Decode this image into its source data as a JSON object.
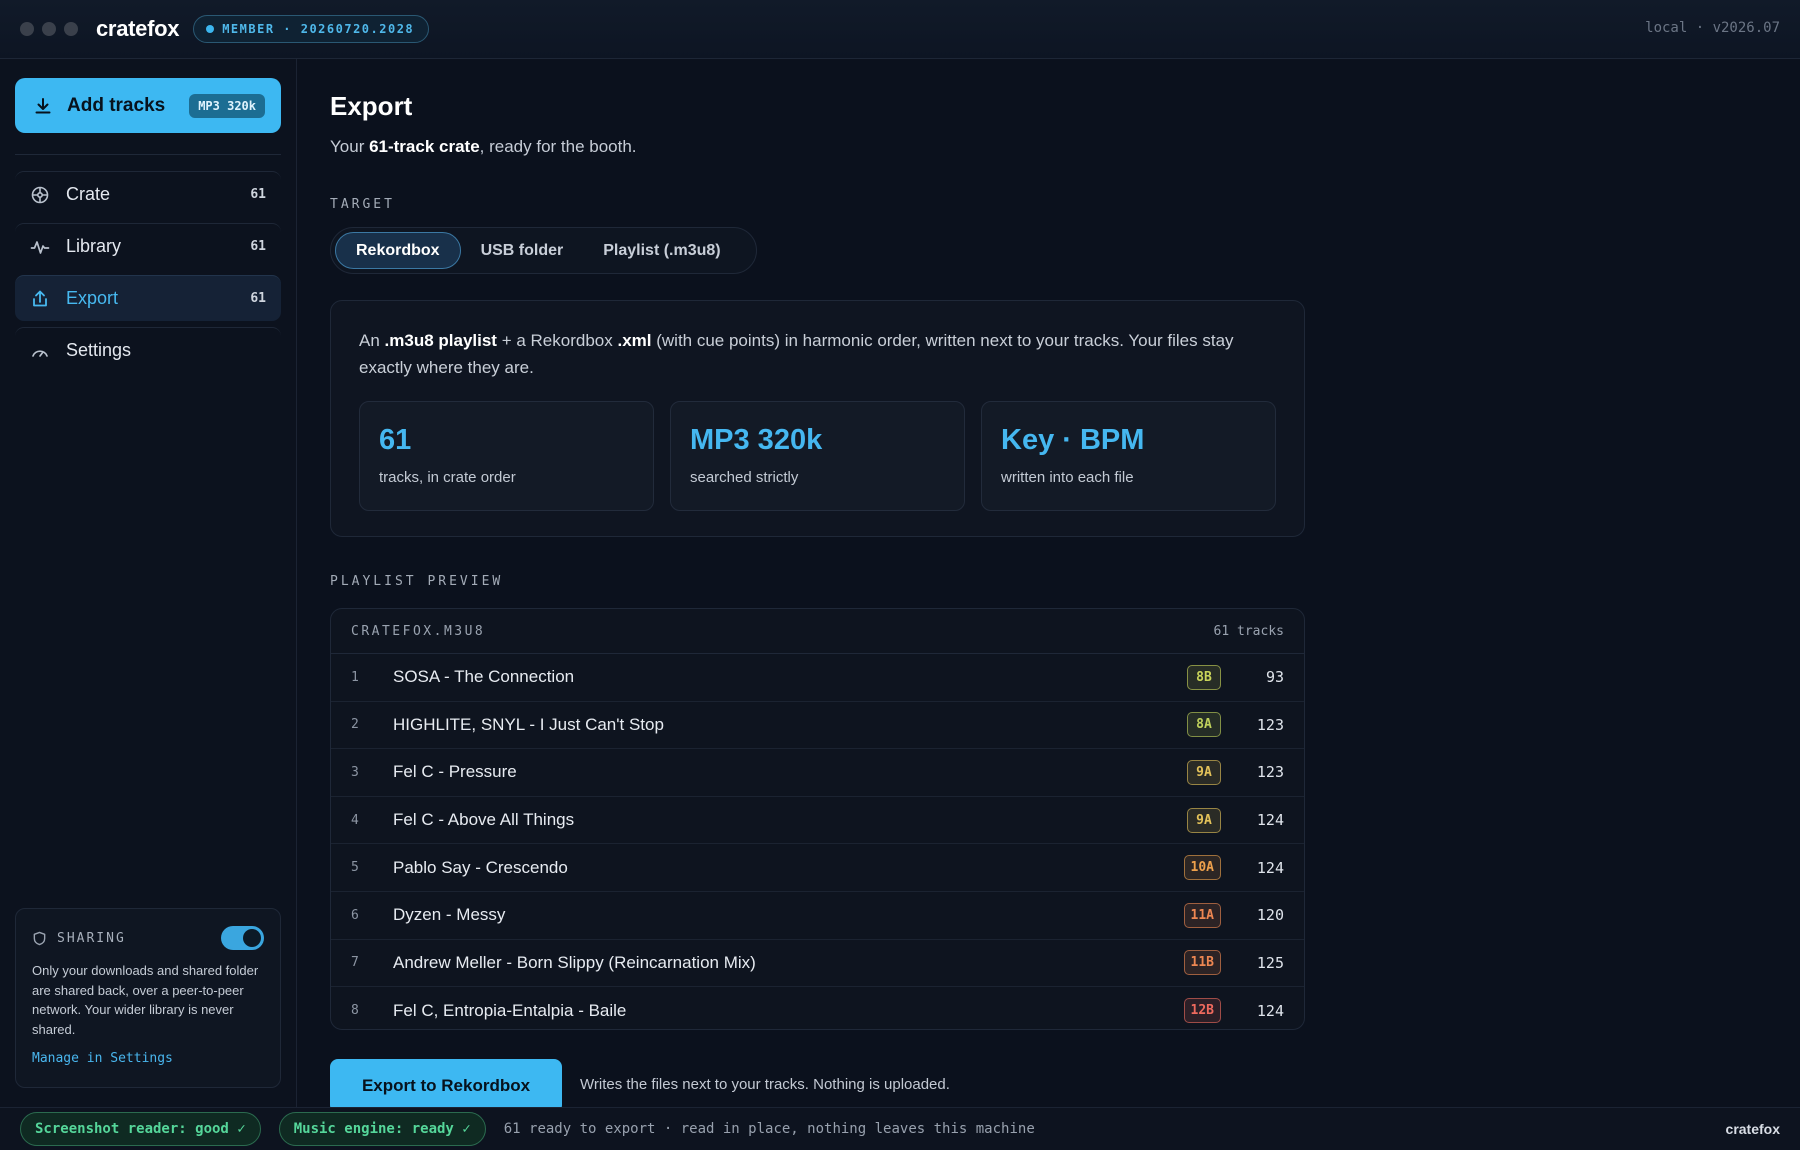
{
  "titlebar": {
    "brand": "cratefox",
    "member_badge": "MEMBER · 20260720.2028",
    "version": "local · v2026.07"
  },
  "sidebar": {
    "add_button": {
      "label": "Add tracks",
      "format": "MP3 320k"
    },
    "items": [
      {
        "label": "Crate",
        "count": "61",
        "icon": "crate-icon"
      },
      {
        "label": "Library",
        "count": "61",
        "icon": "waveform-icon"
      },
      {
        "label": "Export",
        "count": "61",
        "icon": "upload-icon",
        "active": true
      },
      {
        "label": "Settings",
        "count": "",
        "icon": "gauge-icon"
      }
    ],
    "sharing": {
      "title": "SHARING",
      "enabled": true,
      "text": "Only your downloads and shared folder are shared back, over a peer-to-peer network. Your wider library is never shared.",
      "link": "Manage in Settings"
    }
  },
  "main": {
    "title": "Export",
    "subtitle_prefix": "Your ",
    "subtitle_bold": "61-track crate",
    "subtitle_suffix": ", ready for the booth.",
    "target_label": "TARGET",
    "targets": [
      "Rekordbox",
      "USB folder",
      "Playlist (.m3u8)"
    ],
    "active_target": "Rekordbox",
    "card": {
      "desc_1": "An ",
      "desc_b1": ".m3u8 playlist",
      "desc_2": " + a Rekordbox ",
      "desc_b2": ".xml",
      "desc_3": " (with cue points) in harmonic order, written next to your tracks. Your files stay exactly where they are.",
      "stats": [
        {
          "value": "61",
          "caption": "tracks, in crate order"
        },
        {
          "value": "MP3 320k",
          "caption": "searched strictly"
        },
        {
          "value": "Key · BPM",
          "caption": "written into each file"
        }
      ]
    },
    "preview_label": "PLAYLIST PREVIEW",
    "playlist": {
      "name": "CRATEFOX.M3U8",
      "count": "61 tracks",
      "rows": [
        {
          "num": "1",
          "title": "SOSA - The Connection",
          "key": "8B",
          "bpm": "93",
          "key_color": "#c9d45a"
        },
        {
          "num": "2",
          "title": "HIGHLITE, SNYL - I Just Can't Stop",
          "key": "8A",
          "bpm": "123",
          "key_color": "#bfd05c"
        },
        {
          "num": "3",
          "title": "Fel C - Pressure",
          "key": "9A",
          "bpm": "123",
          "key_color": "#e3c25a"
        },
        {
          "num": "4",
          "title": "Fel C - Above All Things",
          "key": "9A",
          "bpm": "124",
          "key_color": "#e3c25a"
        },
        {
          "num": "5",
          "title": "Pablo Say - Crescendo",
          "key": "10A",
          "bpm": "124",
          "key_color": "#eea14c"
        },
        {
          "num": "6",
          "title": "Dyzen - Messy",
          "key": "11A",
          "bpm": "120",
          "key_color": "#ee8752"
        },
        {
          "num": "7",
          "title": "Andrew Meller - Born Slippy (Reincarnation Mix)",
          "key": "11B",
          "bpm": "125",
          "key_color": "#ee8752"
        },
        {
          "num": "8",
          "title": "Fel C, Entropia-Entalpia - Baile",
          "key": "12B",
          "bpm": "124",
          "key_color": "#ef6a5e"
        }
      ]
    },
    "export_button": "Export to Rekordbox",
    "export_note": "Writes the files next to your tracks. Nothing is uploaded."
  },
  "statusbar": {
    "pill_1": "Screenshot reader: good ✓",
    "pill_2": "Music engine: ready ✓",
    "text": "61 ready to export ·  read in place, nothing leaves this machine",
    "brand": "cratefox"
  },
  "colors": {
    "accent": "#3db8f2",
    "background": "#0b111d",
    "status_ok": "#55d69a"
  }
}
